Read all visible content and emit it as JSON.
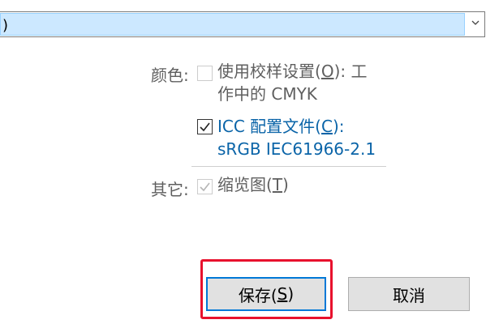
{
  "combo": {
    "text": ")"
  },
  "color": {
    "label": "颜色:",
    "proof": {
      "line1_pre": "使用校样设置(",
      "line1_key": "O",
      "line1_post": "):  工",
      "line2": "作中的 CMYK",
      "checked": false
    },
    "icc": {
      "line1_pre": "ICC 配置文件(",
      "line1_key": "C",
      "line1_post": "):",
      "line2": "sRGB IEC61966-2.1",
      "checked": true
    }
  },
  "other": {
    "label": "其它:",
    "thumbnail": {
      "pre": "缩览图(",
      "key": "T",
      "post": ")",
      "checked": true
    }
  },
  "buttons": {
    "save": {
      "pre": "保存(",
      "key": "S",
      "post": ")"
    },
    "cancel": "取消"
  },
  "colors": {
    "highlight": "#e8112d",
    "link": "#0a64a8",
    "focus": "#0078d7"
  }
}
